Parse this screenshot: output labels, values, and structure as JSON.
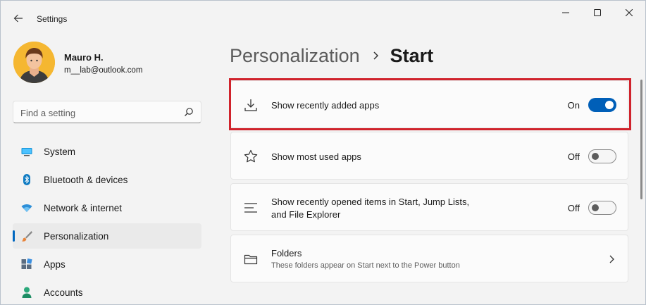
{
  "window": {
    "title": "Settings"
  },
  "profile": {
    "name": "Mauro H.",
    "email": "m__lab@outlook.com"
  },
  "search": {
    "placeholder": "Find a setting"
  },
  "nav": [
    {
      "label": "System",
      "icon": "monitor-icon"
    },
    {
      "label": "Bluetooth & devices",
      "icon": "bluetooth-icon"
    },
    {
      "label": "Network & internet",
      "icon": "wifi-icon"
    },
    {
      "label": "Personalization",
      "icon": "brush-icon",
      "selected": true
    },
    {
      "label": "Apps",
      "icon": "apps-icon"
    },
    {
      "label": "Accounts",
      "icon": "person-icon"
    }
  ],
  "breadcrumb": {
    "parent": "Personalization",
    "current": "Start"
  },
  "settings": [
    {
      "title": "Show recently added apps",
      "state": "On",
      "icon": "download-icon"
    },
    {
      "title": "Show most used apps",
      "state": "Off",
      "icon": "star-icon"
    },
    {
      "title_line1": "Show recently opened items in Start, Jump Lists,",
      "title_line2": "and File Explorer",
      "state": "Off",
      "icon": "list-icon"
    },
    {
      "title": "Folders",
      "subtitle": "These folders appear on Start next to the Power button",
      "icon": "folder-icon"
    }
  ],
  "colors": {
    "accent": "#005fb8",
    "highlight": "#d0232c"
  }
}
